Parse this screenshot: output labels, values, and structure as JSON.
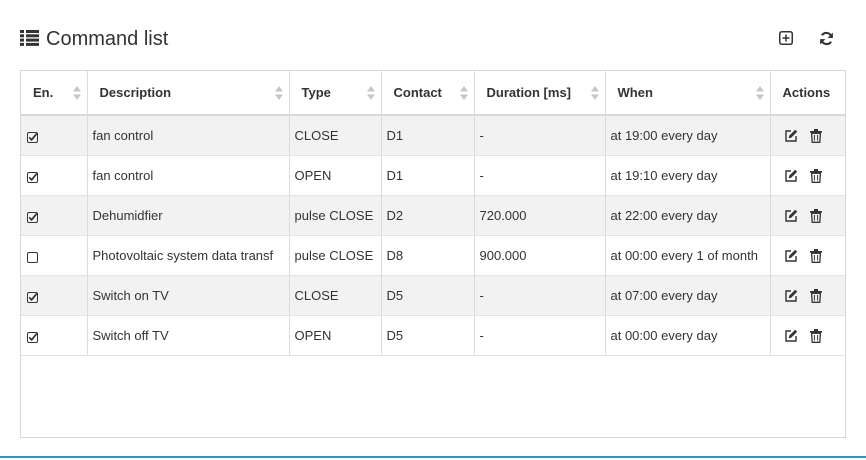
{
  "header": {
    "title": "Command list",
    "title_icon": "list-icon",
    "add_icon": "plus-square-icon",
    "refresh_icon": "refresh-icon"
  },
  "table": {
    "columns": [
      "En.",
      "Description",
      "Type",
      "Contact",
      "Duration [ms]",
      "When",
      "Actions"
    ],
    "rows": [
      {
        "enabled": true,
        "description": "fan control",
        "type": "CLOSE",
        "contact": "D1",
        "duration": "-",
        "when": "at 19:00 every day"
      },
      {
        "enabled": true,
        "description": "fan control",
        "type": "OPEN",
        "contact": "D1",
        "duration": "-",
        "when": "at 19:10 every day"
      },
      {
        "enabled": true,
        "description": "Dehumidfier",
        "type": "pulse CLOSE",
        "contact": "D2",
        "duration": "720.000",
        "when": "at 22:00 every day"
      },
      {
        "enabled": false,
        "description": "Photovoltaic system data transf",
        "type": "pulse CLOSE",
        "contact": "D8",
        "duration": "900.000",
        "when": "at 00:00 every 1 of month"
      },
      {
        "enabled": true,
        "description": "Switch on TV",
        "type": "CLOSE",
        "contact": "D5",
        "duration": "-",
        "when": "at 07:00 every day"
      },
      {
        "enabled": true,
        "description": "Switch off TV",
        "type": "OPEN",
        "contact": "D5",
        "duration": "-",
        "when": "at 00:00 every day"
      }
    ]
  },
  "colors": {
    "accent": "#3c8dbc",
    "row_alt": "#f2f2f2"
  }
}
